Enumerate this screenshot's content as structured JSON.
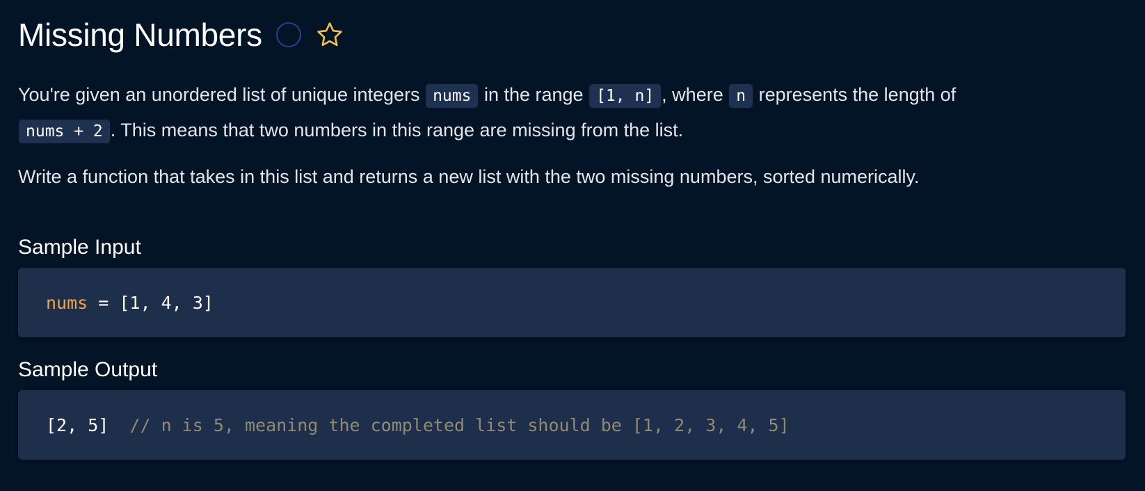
{
  "problem": {
    "title": "Missing Numbers",
    "status_icon": "circle-outline",
    "favorite_icon": "star-outline",
    "favorite_color": "#f2c14e"
  },
  "description": {
    "p1": {
      "t1": "You're given an unordered list of unique integers ",
      "c1": "nums",
      "t2": " in the range ",
      "c2": "[1, n]",
      "t3": ", where ",
      "c3": "n",
      "t4": " represents the length of ",
      "c4": "nums + 2",
      "t5": ". This means that two numbers in this range are missing from the list."
    },
    "p2": "Write a function that takes in this list and returns a new list with the two missing numbers, sorted numerically."
  },
  "sample_input": {
    "heading": "Sample Input",
    "var_name": "nums",
    "assign": " = ",
    "value": "[1, 4, 3]"
  },
  "sample_output": {
    "heading": "Sample Output",
    "value": "[2, 5]",
    "comment": "// n is 5, meaning the completed list should be [1, 2, 3, 4, 5]"
  },
  "colors": {
    "background": "#031427",
    "code_block_bg": "#1e2f4b",
    "variable": "#f0a548",
    "comment": "#8f8a72",
    "status_circle": "#2c3f8c"
  }
}
